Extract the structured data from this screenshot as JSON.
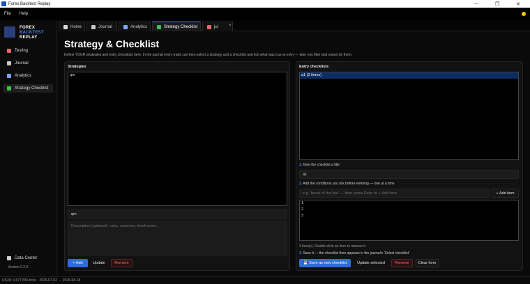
{
  "window": {
    "title": "Forex Backtest Replay",
    "controls": {
      "minimize": "—",
      "maximize": "❐",
      "close": "✕"
    }
  },
  "menu": {
    "items": [
      "File",
      "Help"
    ]
  },
  "status_indicator_color": "#f2c400",
  "logo": {
    "line1": "FOREX",
    "line2": "BACKTEST",
    "line3": "REPLAY"
  },
  "sidebar": {
    "items": [
      {
        "label": "Testing",
        "icon": "chart-icon",
        "color": "#e26a6a"
      },
      {
        "label": "Journal",
        "icon": "notebook-icon",
        "color": "#c9c9c9"
      },
      {
        "label": "Analytics",
        "icon": "bar-chart-icon",
        "color": "#7aa7ff"
      },
      {
        "label": "Strategy  Checklist",
        "icon": "check-icon",
        "color": "#3fbf4f",
        "active": true
      }
    ],
    "bottom_item": {
      "label": "Data Center",
      "icon": "database-icon",
      "color": "#cfcfcf"
    },
    "version": "Version 0.2.3"
  },
  "tabs": [
    {
      "label": "Home",
      "icon": "home-icon",
      "color": "#d8d8d8"
    },
    {
      "label": "Journal",
      "icon": "notebook-icon",
      "color": "#c9c9c9"
    },
    {
      "label": "Analytics",
      "icon": "bar-chart-icon",
      "color": "#7aa7ff"
    },
    {
      "label": "Strategy  Checklist",
      "icon": "check-icon",
      "color": "#3fbf4f",
      "active": true
    },
    {
      "label": "jul",
      "icon": "chart-icon",
      "color": "#e26a6a"
    }
  ],
  "tab_close": "×",
  "page": {
    "title": "Strategy & Checklist",
    "description": "Define YOUR strategies and entry checklists here. In the journal every trade can then select a strategy and a checklist and tick what was true at entry — later you filter and export by them."
  },
  "strategies": {
    "title": "Strategies",
    "items": [
      "qm"
    ],
    "name_value": "qm",
    "description_placeholder": "Description (optional): rules, sessions, timeframes...",
    "buttons": {
      "add": "+ Add",
      "update": "Update",
      "remove": "Remove"
    }
  },
  "checklists": {
    "title": "Entry checklists",
    "items": [
      "a1  (3 items)"
    ],
    "step1_num": "1.",
    "step1": "Give the checklist a title",
    "title_value": "a1",
    "step2_num": "2.",
    "step2": "Add the conditions you tick before entering — one at a time",
    "condition_placeholder": "e.g. 'break of the line' — then press Enter or + Add item",
    "add_item": "+ Add item",
    "conditions": [
      "1",
      "2",
      "3"
    ],
    "count_hint": "3 item(s). Double-click an item to remove it.",
    "step3_num": "3.",
    "step3": "Save it — the checklist then appears in the journal's 'Select checklist'",
    "buttons": {
      "save_new": "💾 Save as new checklist",
      "update_selected": "Update selected",
      "remove": "Remove",
      "clear": "Clear form"
    }
  },
  "statusbar": {
    "text": "US30: 4,577,556 ticks · 2026-07-02 → 2026-08-18"
  }
}
